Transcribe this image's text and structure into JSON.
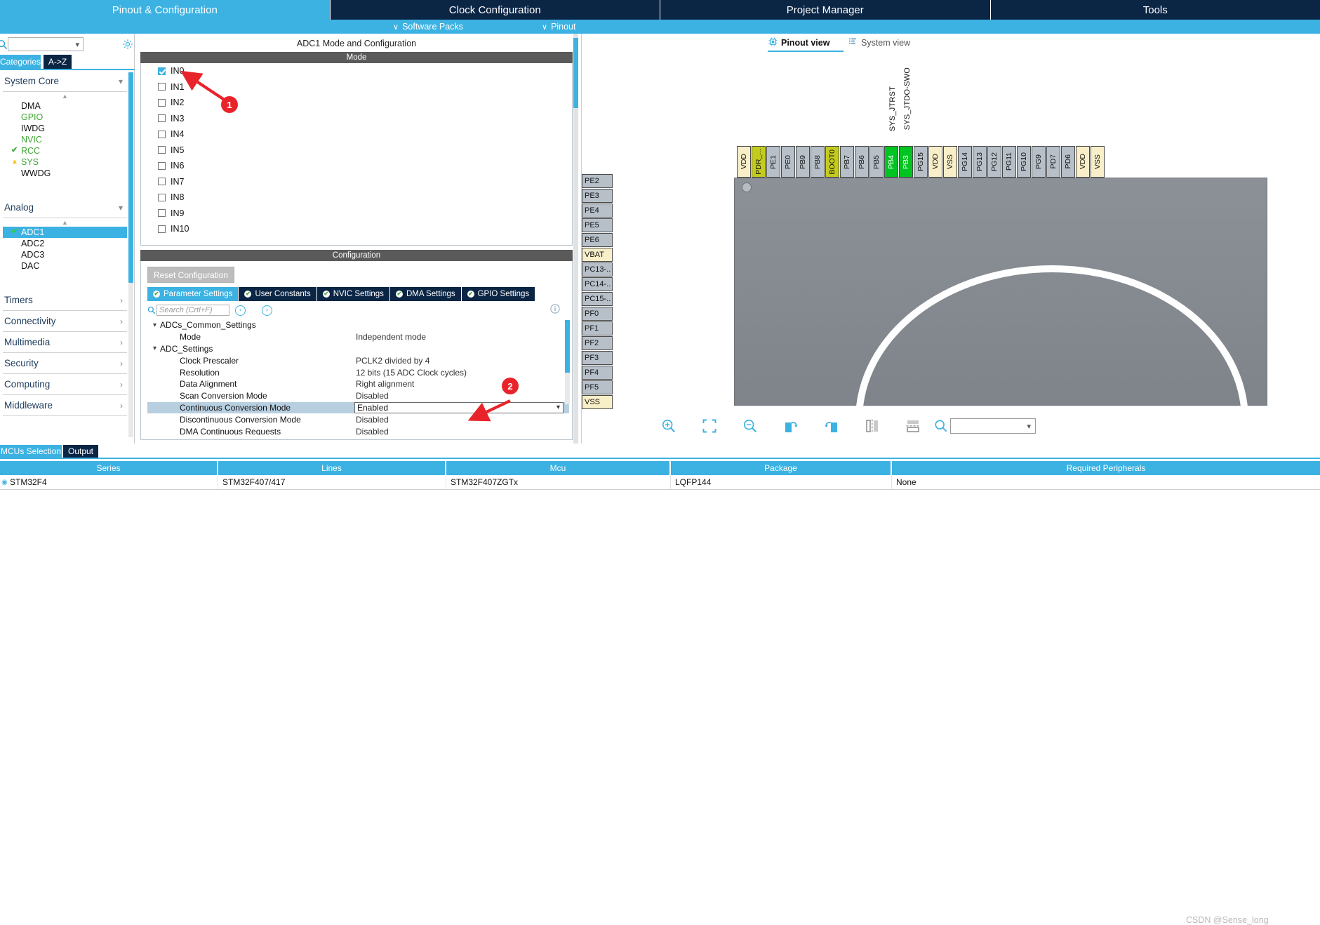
{
  "top_tabs": [
    {
      "label": "Pinout & Configuration",
      "active": true
    },
    {
      "label": "Clock Configuration",
      "active": false
    },
    {
      "label": "Project Manager",
      "active": false
    },
    {
      "label": "Tools",
      "active": false
    }
  ],
  "menu": {
    "software_packs": "Software Packs",
    "pinout": "Pinout",
    "chevron": "∨"
  },
  "left_panel": {
    "search_placeholder": "",
    "gear_icon": "gear-icon",
    "tabs": {
      "categories": "Categories",
      "az": "A->Z"
    },
    "groups": [
      {
        "name": "System Core",
        "expanded": true,
        "items": [
          {
            "label": "DMA",
            "state": "none"
          },
          {
            "label": "GPIO",
            "state": "configured"
          },
          {
            "label": "IWDG",
            "state": "none"
          },
          {
            "label": "NVIC",
            "state": "configured"
          },
          {
            "label": "RCC",
            "state": "ok"
          },
          {
            "label": "SYS",
            "state": "warn"
          },
          {
            "label": "WWDG",
            "state": "none"
          }
        ]
      },
      {
        "name": "Analog",
        "expanded": true,
        "items": [
          {
            "label": "ADC1",
            "state": "ok",
            "selected": true
          },
          {
            "label": "ADC2",
            "state": "none"
          },
          {
            "label": "ADC3",
            "state": "none"
          },
          {
            "label": "DAC",
            "state": "none"
          }
        ]
      },
      {
        "name": "Timers",
        "expanded": false,
        "items": []
      },
      {
        "name": "Connectivity",
        "expanded": false,
        "items": []
      },
      {
        "name": "Multimedia",
        "expanded": false,
        "items": []
      },
      {
        "name": "Security",
        "expanded": false,
        "items": []
      },
      {
        "name": "Computing",
        "expanded": false,
        "items": []
      },
      {
        "name": "Middleware",
        "expanded": false,
        "items": []
      }
    ]
  },
  "middle_panel": {
    "title": "ADC1 Mode and Configuration",
    "mode_header": "Mode",
    "channels": [
      {
        "label": "IN0",
        "checked": true
      },
      {
        "label": "IN1",
        "checked": false
      },
      {
        "label": "IN2",
        "checked": false
      },
      {
        "label": "IN3",
        "checked": false
      },
      {
        "label": "IN4",
        "checked": false
      },
      {
        "label": "IN5",
        "checked": false
      },
      {
        "label": "IN6",
        "checked": false
      },
      {
        "label": "IN7",
        "checked": false
      },
      {
        "label": "IN8",
        "checked": false
      },
      {
        "label": "IN9",
        "checked": false
      },
      {
        "label": "IN10",
        "checked": false
      }
    ],
    "configuration_header": "Configuration",
    "reset_button": "Reset Configuration",
    "config_tabs": [
      {
        "label": "Parameter Settings",
        "active": true
      },
      {
        "label": "User Constants",
        "active": false
      },
      {
        "label": "NVIC Settings",
        "active": false
      },
      {
        "label": "DMA Settings",
        "active": false
      },
      {
        "label": "GPIO Settings",
        "active": false
      }
    ],
    "param_search_placeholder": "Search (Crtl+F)",
    "parameters": [
      {
        "type": "group",
        "name": "ADCs_Common_Settings",
        "value": ""
      },
      {
        "type": "item",
        "name": "Mode",
        "value": "Independent mode"
      },
      {
        "type": "group",
        "name": "ADC_Settings",
        "value": ""
      },
      {
        "type": "item",
        "name": "Clock Prescaler",
        "value": "PCLK2 divided by 4"
      },
      {
        "type": "item",
        "name": "Resolution",
        "value": "12 bits (15 ADC Clock cycles)"
      },
      {
        "type": "item",
        "name": "Data Alignment",
        "value": "Right alignment"
      },
      {
        "type": "item",
        "name": "Scan Conversion Mode",
        "value": "Disabled"
      },
      {
        "type": "item",
        "name": "Continuous Conversion Mode",
        "value": "Enabled",
        "selected": true,
        "editing": true
      },
      {
        "type": "item",
        "name": "Discontinuous Conversion Mode",
        "value": "Disabled"
      },
      {
        "type": "item",
        "name": "DMA Continuous Requests",
        "value": "Disabled"
      }
    ]
  },
  "right_panel": {
    "view_tabs": [
      {
        "label": "Pinout view",
        "active": true,
        "icon": "chip-icon"
      },
      {
        "label": "System view",
        "active": false,
        "icon": "list-icon"
      }
    ],
    "signal_labels": [
      "SYS_JTRST",
      "SYS_JTDO-SWO"
    ],
    "top_pins": [
      {
        "label": "VDD",
        "type": "power"
      },
      {
        "label": "PDR_...",
        "type": "boot"
      },
      {
        "label": "PE1",
        "type": "io"
      },
      {
        "label": "PE0",
        "type": "io"
      },
      {
        "label": "PB9",
        "type": "io"
      },
      {
        "label": "PB8",
        "type": "io"
      },
      {
        "label": "BOOT0",
        "type": "boot"
      },
      {
        "label": "PB7",
        "type": "io"
      },
      {
        "label": "PB6",
        "type": "io"
      },
      {
        "label": "PB5",
        "type": "io"
      },
      {
        "label": "PB4",
        "type": "active"
      },
      {
        "label": "PB3",
        "type": "active"
      },
      {
        "label": "PG15",
        "type": "io"
      },
      {
        "label": "VDD",
        "type": "power"
      },
      {
        "label": "VSS",
        "type": "power"
      },
      {
        "label": "PG14",
        "type": "io"
      },
      {
        "label": "PG13",
        "type": "io"
      },
      {
        "label": "PG12",
        "type": "io"
      },
      {
        "label": "PG11",
        "type": "io"
      },
      {
        "label": "PG10",
        "type": "io"
      },
      {
        "label": "PG9",
        "type": "io"
      },
      {
        "label": "PD7",
        "type": "io"
      },
      {
        "label": "PD6",
        "type": "io"
      },
      {
        "label": "VDD",
        "type": "power"
      },
      {
        "label": "VSS",
        "type": "power"
      }
    ],
    "left_pins": [
      {
        "label": "PE2",
        "type": "io"
      },
      {
        "label": "PE3",
        "type": "io"
      },
      {
        "label": "PE4",
        "type": "io"
      },
      {
        "label": "PE5",
        "type": "io"
      },
      {
        "label": "PE6",
        "type": "io"
      },
      {
        "label": "VBAT",
        "type": "power"
      },
      {
        "label": "PC13-..",
        "type": "io"
      },
      {
        "label": "PC14-..",
        "type": "io"
      },
      {
        "label": "PC15-..",
        "type": "io"
      },
      {
        "label": "PF0",
        "type": "io"
      },
      {
        "label": "PF1",
        "type": "io"
      },
      {
        "label": "PF2",
        "type": "io"
      },
      {
        "label": "PF3",
        "type": "io"
      },
      {
        "label": "PF4",
        "type": "io"
      },
      {
        "label": "PF5",
        "type": "io"
      },
      {
        "label": "VSS",
        "type": "power"
      }
    ],
    "toolbar": [
      {
        "name": "zoom-in-icon"
      },
      {
        "name": "fit-icon"
      },
      {
        "name": "zoom-out-icon"
      },
      {
        "name": "rotate-right-icon"
      },
      {
        "name": "rotate-left-icon"
      },
      {
        "name": "flip-horizontal-icon"
      },
      {
        "name": "flip-vertical-icon"
      },
      {
        "name": "search-icon"
      }
    ],
    "toolbar_combo_value": ""
  },
  "bottom": {
    "tabs": [
      {
        "label": "MCUs Selection",
        "active": true
      },
      {
        "label": "Output",
        "active": false
      }
    ],
    "columns": [
      "Series",
      "Lines",
      "Mcu",
      "Package",
      "Required Peripherals"
    ],
    "rows": [
      {
        "Series": "STM32F4",
        "Lines": "STM32F407/417",
        "Mcu": "STM32F407ZGTx",
        "Package": "LQFP144",
        "Required Peripherals": "None"
      }
    ]
  },
  "annotations": [
    {
      "number": "1",
      "target": "IN0 checkbox"
    },
    {
      "number": "2",
      "target": "Continuous Conversion Mode value"
    }
  ],
  "watermark": "CSDN @Sense_long",
  "colors": {
    "accent": "#3cb2e2",
    "dark_tab": "#0b2545",
    "annotation_red": "#e8242a",
    "active_pin": "#00c421",
    "boot_pin": "#c3cc1e",
    "power_pin": "#f8eec8"
  }
}
